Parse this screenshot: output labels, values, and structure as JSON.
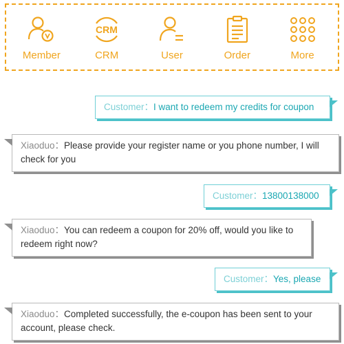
{
  "colors": {
    "accent": "#f0a51e",
    "customer": "#1aa7b2",
    "bot_border": "#b9b9b9"
  },
  "toolbar": {
    "items": [
      {
        "label": "Member",
        "icon": "member-icon"
      },
      {
        "label": "CRM",
        "icon": "crm-icon",
        "icon_text": "CRM"
      },
      {
        "label": "User",
        "icon": "user-icon"
      },
      {
        "label": "Order",
        "icon": "order-icon"
      },
      {
        "label": "More",
        "icon": "more-icon"
      }
    ]
  },
  "chat": {
    "messages": [
      {
        "speaker": "Customer：",
        "text": "I want to redeem my credits for coupon"
      },
      {
        "speaker": "Xiaoduo：",
        "text": "Please provide your register name or you phone number,  I will check for you"
      },
      {
        "speaker": "Customer：",
        "text": "13800138000"
      },
      {
        "speaker": "Xiaoduo：",
        "text": "You can redeem a coupon for 20% off,  would you like to redeem right now?"
      },
      {
        "speaker": "Customer：",
        "text": "Yes, please"
      },
      {
        "speaker": "Xiaoduo：",
        "text": "Completed successfully, the e-coupon has been sent to your account,  please check."
      }
    ]
  }
}
